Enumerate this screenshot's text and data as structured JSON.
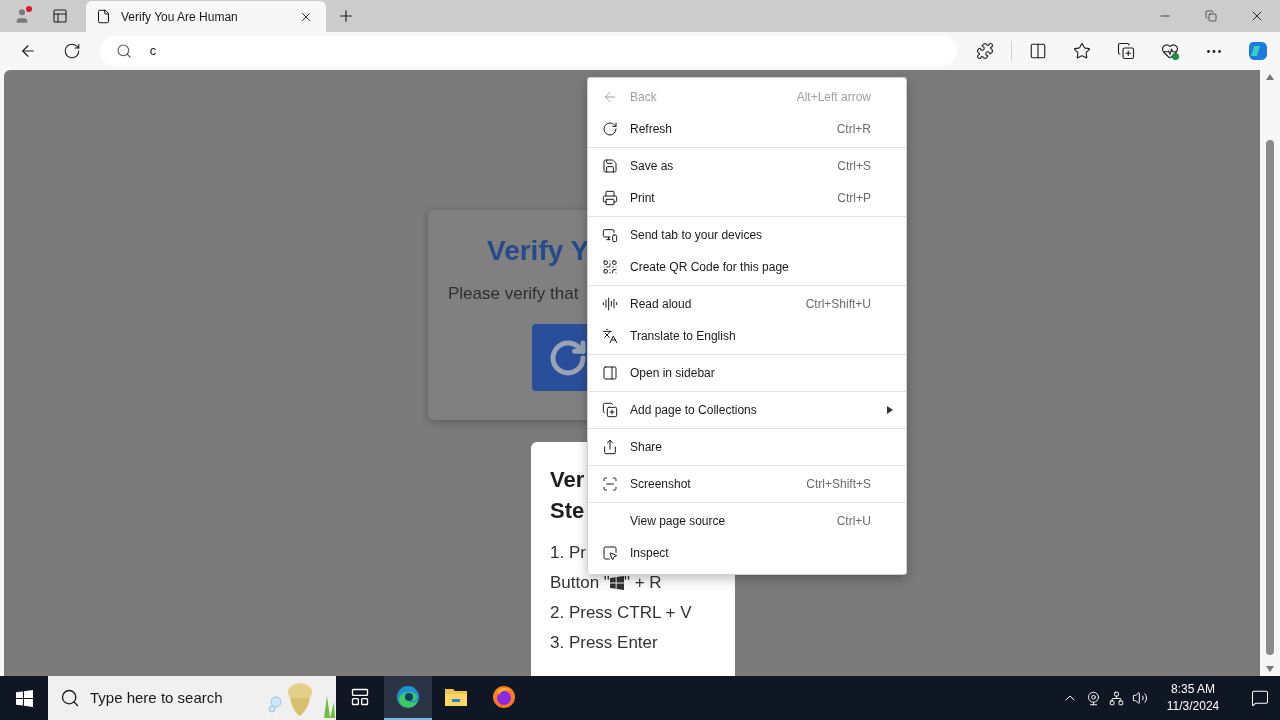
{
  "browser": {
    "tab": {
      "title": "Verify You Are Human"
    },
    "address_bar": {
      "value": "c"
    }
  },
  "page": {
    "verify_card": {
      "title": "Verify Y",
      "text": "Please verify that"
    },
    "instructions": {
      "title_lines": [
        "Ver",
        "Ste"
      ],
      "steps": [
        {
          "text": "1. Pr",
          "continuation": {
            "before": "Button \"",
            "after": "\" + R"
          }
        },
        {
          "text": "2. Press CTRL + V"
        },
        {
          "text": "3. Press Enter"
        }
      ]
    }
  },
  "context_menu": {
    "groups": [
      [
        {
          "label": "Back",
          "shortcut": "Alt+Left arrow",
          "disabled": true,
          "submenu": false
        },
        {
          "label": "Refresh",
          "shortcut": "Ctrl+R",
          "disabled": false,
          "submenu": false
        }
      ],
      [
        {
          "label": "Save as",
          "shortcut": "Ctrl+S",
          "disabled": false,
          "submenu": false
        },
        {
          "label": "Print",
          "shortcut": "Ctrl+P",
          "disabled": false,
          "submenu": false
        }
      ],
      [
        {
          "label": "Send tab to your devices",
          "disabled": false,
          "submenu": false
        },
        {
          "label": "Create QR Code for this page",
          "disabled": false,
          "submenu": false
        }
      ],
      [
        {
          "label": "Read aloud",
          "shortcut": "Ctrl+Shift+U",
          "disabled": false,
          "submenu": false
        },
        {
          "label": "Translate to English",
          "disabled": false,
          "submenu": false
        }
      ],
      [
        {
          "label": "Open in sidebar",
          "disabled": false,
          "submenu": false
        }
      ],
      [
        {
          "label": "Add page to Collections",
          "disabled": false,
          "submenu": true
        }
      ],
      [
        {
          "label": "Share",
          "disabled": false,
          "submenu": false
        }
      ],
      [
        {
          "label": "Screenshot",
          "shortcut": "Ctrl+Shift+S",
          "disabled": false,
          "submenu": false
        }
      ],
      [
        {
          "label": "View page source",
          "shortcut": "Ctrl+U",
          "disabled": false,
          "submenu": false
        },
        {
          "label": "Inspect",
          "disabled": false,
          "submenu": false
        }
      ]
    ]
  },
  "taskbar": {
    "search": {
      "placeholder": "Type here to search"
    },
    "apps": [
      {
        "selected": false
      },
      {
        "selected": true
      },
      {
        "selected": false
      },
      {
        "selected": false
      }
    ],
    "clock": {
      "time": "8:35 AM",
      "date": "11/3/2024"
    }
  }
}
